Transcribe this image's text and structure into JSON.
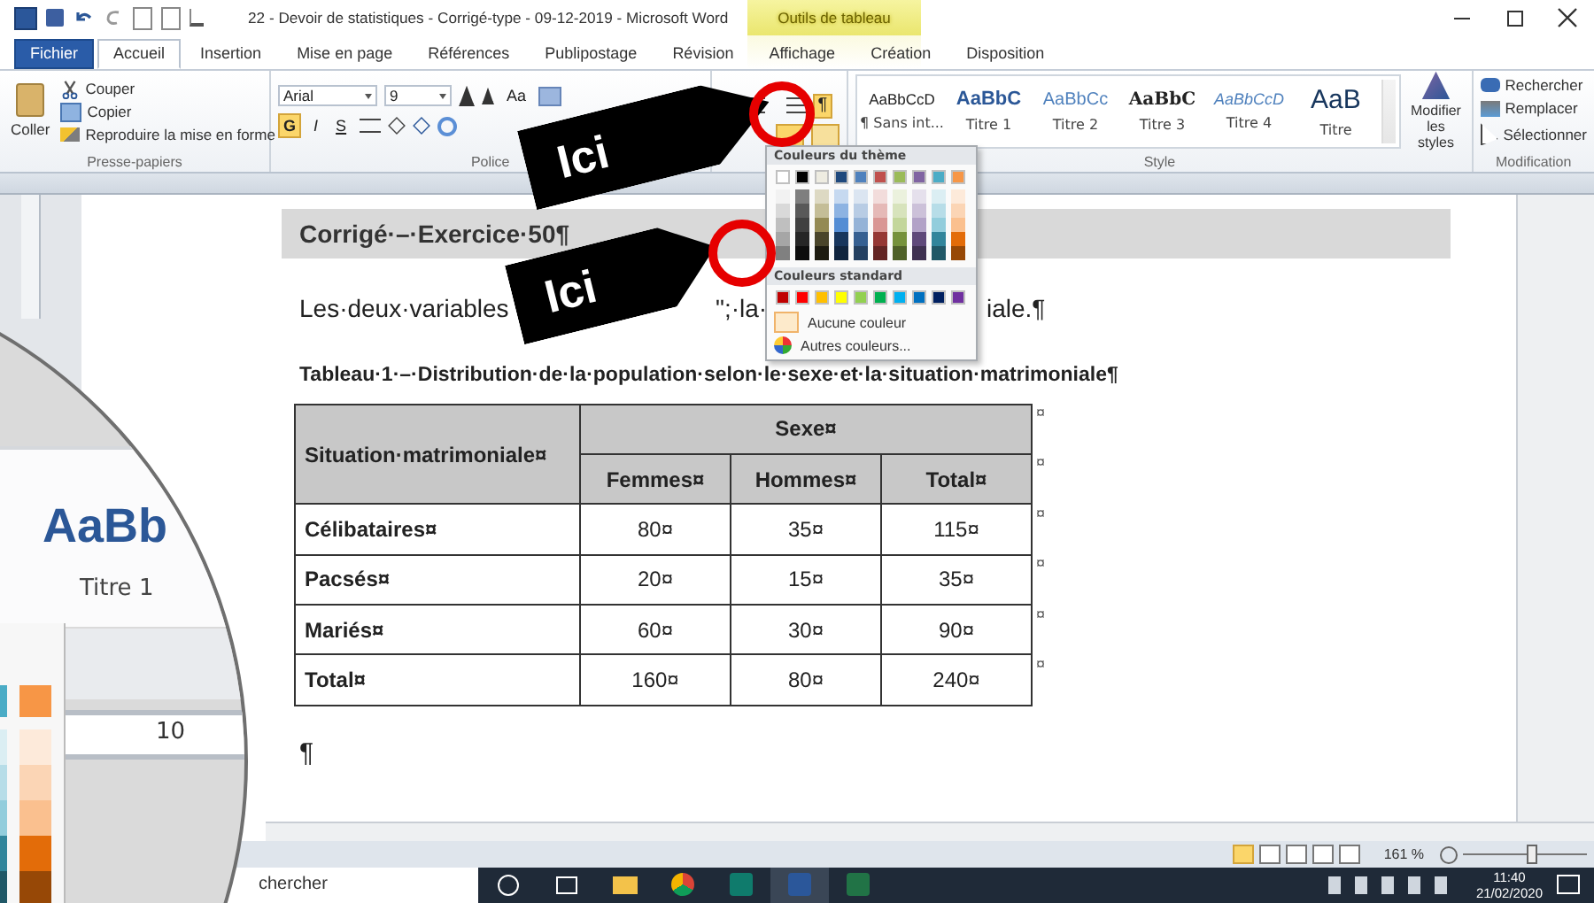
{
  "title_bar": {
    "title": "22 - Devoir de statistiques - Corrigé-type - 09-12-2019  -  Microsoft Word",
    "context_header": "Outils de tableau"
  },
  "tabs": [
    {
      "label": "Fichier",
      "kind": "file",
      "selected": false
    },
    {
      "label": "Accueil",
      "kind": "normal",
      "selected": true
    },
    {
      "label": "Insertion",
      "kind": "normal",
      "selected": false
    },
    {
      "label": "Mise en page",
      "kind": "normal",
      "selected": false
    },
    {
      "label": "Références",
      "kind": "normal",
      "selected": false
    },
    {
      "label": "Publipostage",
      "kind": "normal",
      "selected": false
    },
    {
      "label": "Révision",
      "kind": "normal",
      "selected": false
    },
    {
      "label": "Affichage",
      "kind": "normal",
      "selected": false
    },
    {
      "label": "Création",
      "kind": "context",
      "selected": false
    },
    {
      "label": "Disposition",
      "kind": "context",
      "selected": false
    }
  ],
  "ribbon": {
    "clipboard": {
      "paste": "Coller",
      "cut": "Couper",
      "copy": "Copier",
      "format_painter": "Reproduire la mise en forme",
      "label": "Presse-papiers"
    },
    "font": {
      "name": "Arial",
      "size": "9",
      "change_case": "Aa",
      "bold": {
        "label": "G",
        "on": true
      },
      "italic": "I",
      "underline": "S",
      "label": "Police"
    },
    "paragraph": {
      "show_marks": {
        "label": "¶",
        "on": true
      }
    },
    "styles": {
      "items": [
        {
          "sample": "AaBbCcD",
          "name": "¶ Sans int...",
          "kind": "normal"
        },
        {
          "sample": "AaBbC",
          "name": "Titre 1",
          "kind": "h1"
        },
        {
          "sample": "AaBbCc",
          "name": "Titre 2",
          "kind": "h2"
        },
        {
          "sample": "AaBbC",
          "name": "Titre 3",
          "kind": "h3"
        },
        {
          "sample": "AaBbCcD",
          "name": "Titre 4",
          "kind": "h4"
        },
        {
          "sample": "AaB",
          "name": "Titre",
          "kind": "title"
        }
      ],
      "change_styles": "Modifier les styles",
      "label": "Style"
    },
    "editing": {
      "find": "Rechercher",
      "replace": "Remplacer",
      "select": "Sélectionner",
      "label": "Modification"
    }
  },
  "document": {
    "heading": "Corrigé·–·Exercice·50¶",
    "paragraph": [
      "Les·deux·variables",
      "\";·la·",
      "iale.¶"
    ],
    "caption": "Tableau·1·–·Distribution·de·la·population·selon·le·sexe·et·la·situation·matrimoniale¶",
    "table": {
      "row_label": "Situation·matrimoniale¤",
      "group": "Sexe¤",
      "columns": [
        "Femmes¤",
        "Hommes¤",
        "Total¤"
      ],
      "rows": [
        {
          "label": "Célibataires¤",
          "cells": [
            "80¤",
            "35¤",
            "115¤"
          ]
        },
        {
          "label": "Pacsés¤",
          "cells": [
            "20¤",
            "15¤",
            "35¤"
          ]
        },
        {
          "label": "Mariés¤",
          "cells": [
            "60¤",
            "30¤",
            "90¤"
          ]
        },
        {
          "label": "Total¤",
          "cells": [
            "160¤",
            "80¤",
            "240¤"
          ]
        }
      ],
      "row_end_marks": [
        "¤",
        "¤",
        "¤",
        "¤",
        "¤",
        "¤"
      ]
    },
    "empty_paragraph": "¶"
  },
  "callouts": [
    "Ici",
    "Ici"
  ],
  "color_menu": {
    "theme_heading": "Couleurs du thème",
    "theme_columns": [
      {
        "color": "#ffffff",
        "shades": [
          {
            "color": "#f2f2f2"
          },
          {
            "color": "#d9d9d9"
          },
          {
            "color": "#bfbfbf"
          },
          {
            "color": "#a6a6a6"
          },
          {
            "color": "#808080"
          }
        ]
      },
      {
        "color": "#000000",
        "shades": [
          {
            "color": "#7f7f7f"
          },
          {
            "color": "#595959"
          },
          {
            "color": "#404040"
          },
          {
            "color": "#262626"
          },
          {
            "color": "#0d0d0d"
          }
        ]
      },
      {
        "color": "#eeece1",
        "shades": [
          {
            "color": "#ddd9c3"
          },
          {
            "color": "#c4bd97"
          },
          {
            "color": "#948a54"
          },
          {
            "color": "#4a452a"
          },
          {
            "color": "#1d1b10"
          }
        ]
      },
      {
        "color": "#1f497d",
        "shades": [
          {
            "color": "#c6d9f0"
          },
          {
            "color": "#8db3e2"
          },
          {
            "color": "#548dd4"
          },
          {
            "color": "#17365d"
          },
          {
            "color": "#0f243e"
          }
        ]
      },
      {
        "color": "#4f81bd",
        "shades": [
          {
            "color": "#dbe5f1"
          },
          {
            "color": "#b8cce4"
          },
          {
            "color": "#95b3d7"
          },
          {
            "color": "#366092"
          },
          {
            "color": "#244061"
          }
        ]
      },
      {
        "color": "#c0504d",
        "shades": [
          {
            "color": "#f2dcdb"
          },
          {
            "color": "#e5b9b7"
          },
          {
            "color": "#d99694"
          },
          {
            "color": "#953734"
          },
          {
            "color": "#632423"
          }
        ]
      },
      {
        "color": "#9bbb59",
        "shades": [
          {
            "color": "#ebf1dd"
          },
          {
            "color": "#d7e3bc"
          },
          {
            "color": "#c3d69b"
          },
          {
            "color": "#76923c"
          },
          {
            "color": "#4f6128"
          }
        ]
      },
      {
        "color": "#8064a2",
        "shades": [
          {
            "color": "#e5e0ec"
          },
          {
            "color": "#ccc1d9"
          },
          {
            "color": "#b2a2c7"
          },
          {
            "color": "#5f497a"
          },
          {
            "color": "#3f3151"
          }
        ]
      },
      {
        "color": "#4bacc6",
        "shades": [
          {
            "color": "#dbeef3"
          },
          {
            "color": "#b7dde8"
          },
          {
            "color": "#92cddc"
          },
          {
            "color": "#31859b"
          },
          {
            "color": "#205867"
          }
        ]
      },
      {
        "color": "#f79646",
        "shades": [
          {
            "color": "#fdeada"
          },
          {
            "color": "#fbd5b5"
          },
          {
            "color": "#fac08f"
          },
          {
            "color": "#e36c09"
          },
          {
            "color": "#974806"
          }
        ]
      }
    ],
    "standard_heading": "Couleurs standard",
    "standard_colors": [
      {
        "color": "#c00000"
      },
      {
        "color": "#ff0000"
      },
      {
        "color": "#ffc000"
      },
      {
        "color": "#ffff00"
      },
      {
        "color": "#92d050"
      },
      {
        "color": "#00b050"
      },
      {
        "color": "#00b0f0"
      },
      {
        "color": "#0070c0"
      },
      {
        "color": "#002060"
      },
      {
        "color": "#7030a0"
      }
    ],
    "no_color": "Aucune couleur",
    "more_colors": "Autres couleurs..."
  },
  "magnifier": {
    "style_sample": "AaBb",
    "style_name": "Titre 1",
    "ruler_number": "10"
  },
  "status_bar": {
    "zoom": "161 %",
    "zoom_slider": {
      "level": 0.55
    }
  },
  "taskbar": {
    "search_placeholder": "chercher",
    "time": "11:40",
    "date": "21/02/2020"
  }
}
